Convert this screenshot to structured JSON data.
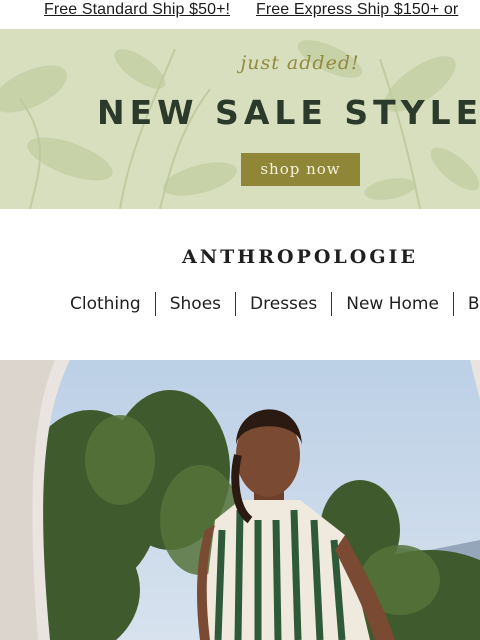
{
  "shipping_bar": {
    "standard": "Free Standard Ship $50+!",
    "express": "Free Express Ship $150+ or"
  },
  "banner": {
    "kicker": "just added!",
    "headline": "NEW SALE STYLES",
    "cta": "shop now"
  },
  "brand": {
    "name": "ANTHROPOLOGIE"
  },
  "nav": {
    "items": [
      {
        "label": "Clothing"
      },
      {
        "label": "Shoes"
      },
      {
        "label": "Dresses"
      },
      {
        "label": "New Home"
      },
      {
        "label": "B"
      }
    ]
  },
  "colors": {
    "banner_bg": "#d7dfbf",
    "accent": "#8f8737",
    "headline": "#2b3a2a"
  }
}
